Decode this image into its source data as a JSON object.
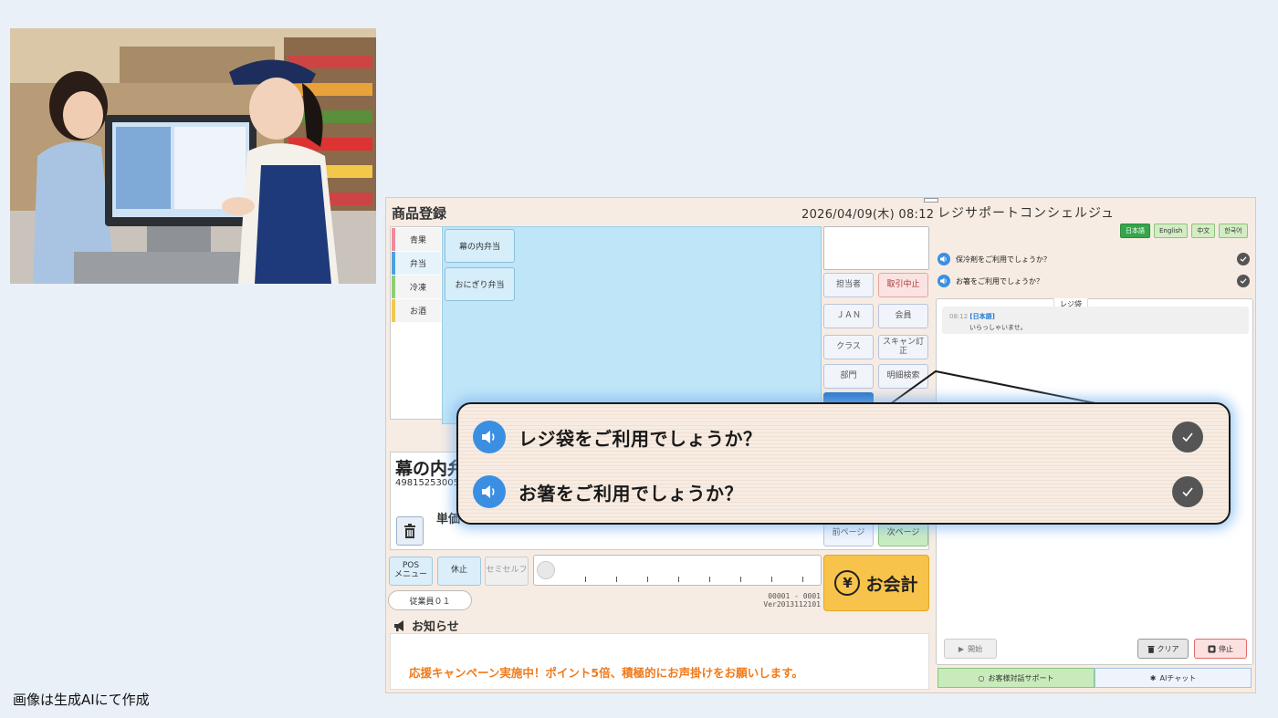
{
  "caption": "画像は生成AIにて作成",
  "pos": {
    "title": "商品登録",
    "datetime": "2026/04/09(木) 08:12",
    "categories": [
      "青果",
      "弁当",
      "冷凍",
      "お酒"
    ],
    "products": [
      "幕の内弁当",
      "おにぎり弁当"
    ],
    "func_buttons": {
      "tantousha": "担当者",
      "torihiki_chushi": "取引中止",
      "jan": "ＪＡＮ",
      "kaiin": "会員",
      "class": "クラス",
      "scan_teisei": "スキャン訂正",
      "bumon": "部門",
      "meisai_kensaku": "明細検索"
    },
    "item": {
      "name": "幕の内弁",
      "code": "49815253005",
      "unit_price_label": "単価"
    },
    "paging": {
      "prev": "前ページ",
      "next": "次ページ"
    },
    "controls": {
      "pos_menu": "POS\nメニュー",
      "kyushi": "休止",
      "semiself": "セミセルフ"
    },
    "pay_label": "お会計",
    "pay_symbol": "¥",
    "staff": "従業員０１",
    "version_line1": "00001 - 0001",
    "version_line2": "Ver2013112101",
    "notice_title": "お知らせ",
    "notice_text": "応援キャンペーン実施中！ポイント5倍、積極的にお声掛けをお願いします。"
  },
  "concierge": {
    "title": "レジサポートコンシェルジュ",
    "languages": [
      "日本語",
      "English",
      "中文",
      "한국어"
    ],
    "active_language": "日本語",
    "questions": [
      "保冷剤をご利用でしょうか？",
      "お箸をご利用でしょうか？"
    ],
    "chat_tag": "レジ袋",
    "chat_time": "08:12",
    "chat_lang": "[日本語]",
    "chat_text": "いらっしゃいませ。",
    "start": "開始",
    "clear": "クリア",
    "stop": "停止",
    "tab_support": "お客様対話サポート",
    "tab_ai": "AIチャット"
  },
  "callout": {
    "questions": [
      "レジ袋をご利用でしょうか？",
      "お箸をご利用でしょうか？"
    ]
  },
  "icons": {
    "speaker": "speaker-icon",
    "check": "check-icon",
    "trash": "trash-icon",
    "megaphone": "megaphone-icon",
    "yen": "yen-icon"
  }
}
